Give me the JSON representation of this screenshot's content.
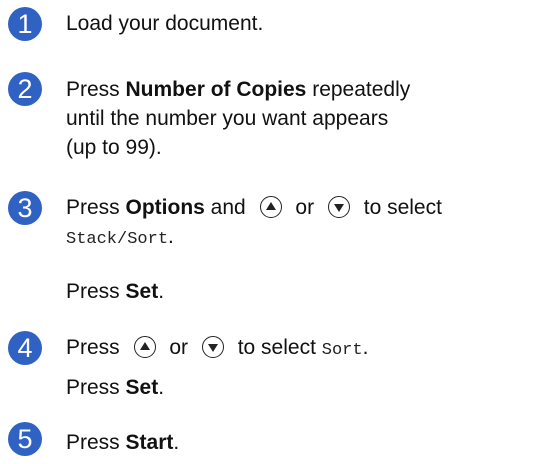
{
  "steps": [
    {
      "number": "1",
      "text": "Load your document."
    },
    {
      "number": "2",
      "pre": "Press ",
      "bold": "Number of Copies",
      "post": " repeatedly",
      "line2": "until the number you want appears",
      "line3": "(up to 99)."
    },
    {
      "number": "3",
      "pre": "Press ",
      "bold": "Options",
      "and": " and ",
      "or": " or ",
      "to_select": " to select",
      "code": "Stack/Sort",
      "code_end": ".",
      "press": "Press ",
      "set": "Set",
      "set_end": "."
    },
    {
      "number": "4",
      "pre": "Press ",
      "or": " or ",
      "to_select": " to select ",
      "code": "Sort",
      "code_end": ".",
      "press": "Press ",
      "set": "Set",
      "set_end": "."
    },
    {
      "number": "5",
      "pre": "Press ",
      "bold": "Start",
      "post": "."
    }
  ],
  "icons": {
    "step_badge_color": "#2f62c2",
    "up_button": "up-arrow-button-icon",
    "down_button": "down-arrow-button-icon"
  }
}
